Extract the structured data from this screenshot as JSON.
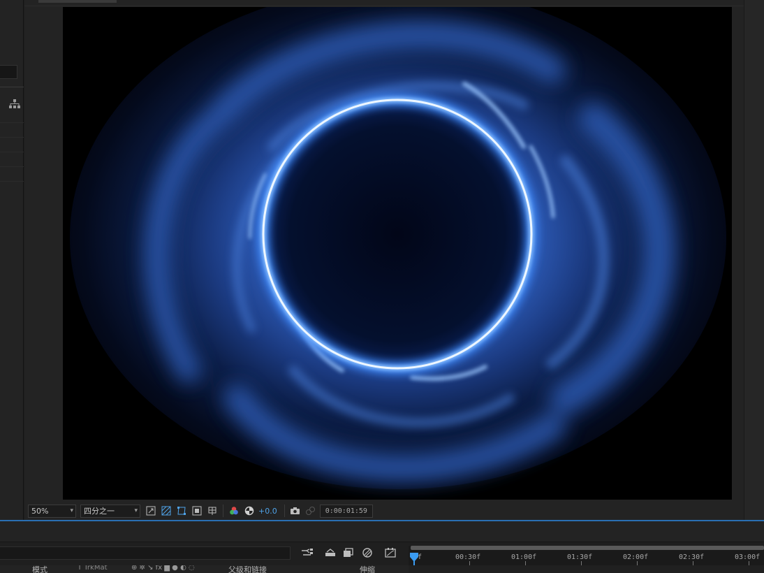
{
  "viewer_toolbar": {
    "zoom_value": "50%",
    "resolution_value": "四分之一",
    "exposure_value": "+0.0",
    "current_time": "0:00:01:59"
  },
  "timeline": {
    "ruler_labels": [
      "0f",
      "00:30f",
      "01:00f",
      "01:30f",
      "02:00f",
      "02:30f",
      "03:00f"
    ],
    "columns": {
      "mode": "模式",
      "trkmat": "T TrkMat",
      "parent_link": "父级和链接",
      "stretch": "伸缩"
    }
  },
  "colors": {
    "accent_blue": "#2a6fb3",
    "exposure_blue": "#4fa3e8",
    "ring_glow": "#d6ecff",
    "nebula_blue": "#2f5db8"
  }
}
